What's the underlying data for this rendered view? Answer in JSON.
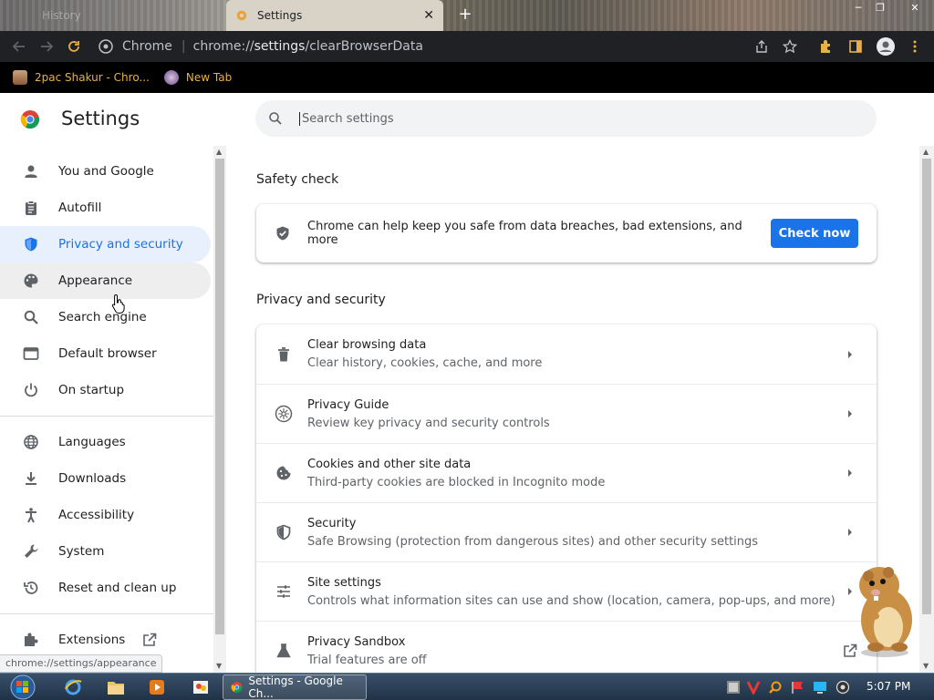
{
  "browser": {
    "tabs": [
      {
        "title": "History"
      },
      {
        "title": "Settings"
      }
    ],
    "omnibox": {
      "site": "Chrome",
      "url_scheme": "chrome://",
      "url_host": "settings",
      "url_path": "/clearBrowserData"
    },
    "bookmarks": [
      {
        "label": "2pac Shakur - Chro..."
      },
      {
        "label": "New Tab"
      }
    ],
    "status_url": "chrome://settings/appearance"
  },
  "settings": {
    "title": "Settings",
    "search": {
      "placeholder": "Search settings"
    },
    "nav": [
      {
        "label": "You and Google",
        "icon": "person-icon"
      },
      {
        "label": "Autofill",
        "icon": "clipboard-icon"
      },
      {
        "label": "Privacy and security",
        "icon": "shield-icon",
        "active": true
      },
      {
        "label": "Appearance",
        "icon": "palette-icon"
      },
      {
        "label": "Search engine",
        "icon": "search-icon"
      },
      {
        "label": "Default browser",
        "icon": "browser-icon"
      },
      {
        "label": "On startup",
        "icon": "power-icon"
      },
      {
        "label": "Languages",
        "icon": "globe-icon"
      },
      {
        "label": "Downloads",
        "icon": "download-icon"
      },
      {
        "label": "Accessibility",
        "icon": "accessibility-icon"
      },
      {
        "label": "System",
        "icon": "wrench-icon"
      },
      {
        "label": "Reset and clean up",
        "icon": "restore-icon"
      },
      {
        "label": "Extensions",
        "icon": "puzzle-icon"
      }
    ],
    "safety_check": {
      "heading": "Safety check",
      "text": "Chrome can help keep you safe from data breaches, bad extensions, and more",
      "button": "Check now"
    },
    "privacy": {
      "heading": "Privacy and security",
      "rows": [
        {
          "title": "Clear browsing data",
          "subtitle": "Clear history, cookies, cache, and more",
          "icon": "trash-icon"
        },
        {
          "title": "Privacy Guide",
          "subtitle": "Review key privacy and security controls",
          "icon": "compass-icon"
        },
        {
          "title": "Cookies and other site data",
          "subtitle": "Third-party cookies are blocked in Incognito mode",
          "icon": "cookie-icon"
        },
        {
          "title": "Security",
          "subtitle": "Safe Browsing (protection from dangerous sites) and other security settings",
          "icon": "shield-icon"
        },
        {
          "title": "Site settings",
          "subtitle": "Controls what information sites can use and show (location, camera, pop-ups, and more)",
          "icon": "sliders-icon"
        },
        {
          "title": "Privacy Sandbox",
          "subtitle": "Trial features are off",
          "icon": "flask-icon"
        }
      ]
    }
  },
  "taskbar": {
    "active_window": "Settings - Google Ch...",
    "clock": "5:07 PM"
  },
  "colors": {
    "accent": "#1a73e8",
    "nav_active_bg": "#e8f0fe",
    "toolbar": "#202124",
    "bookmarks_bar": "#000000"
  }
}
